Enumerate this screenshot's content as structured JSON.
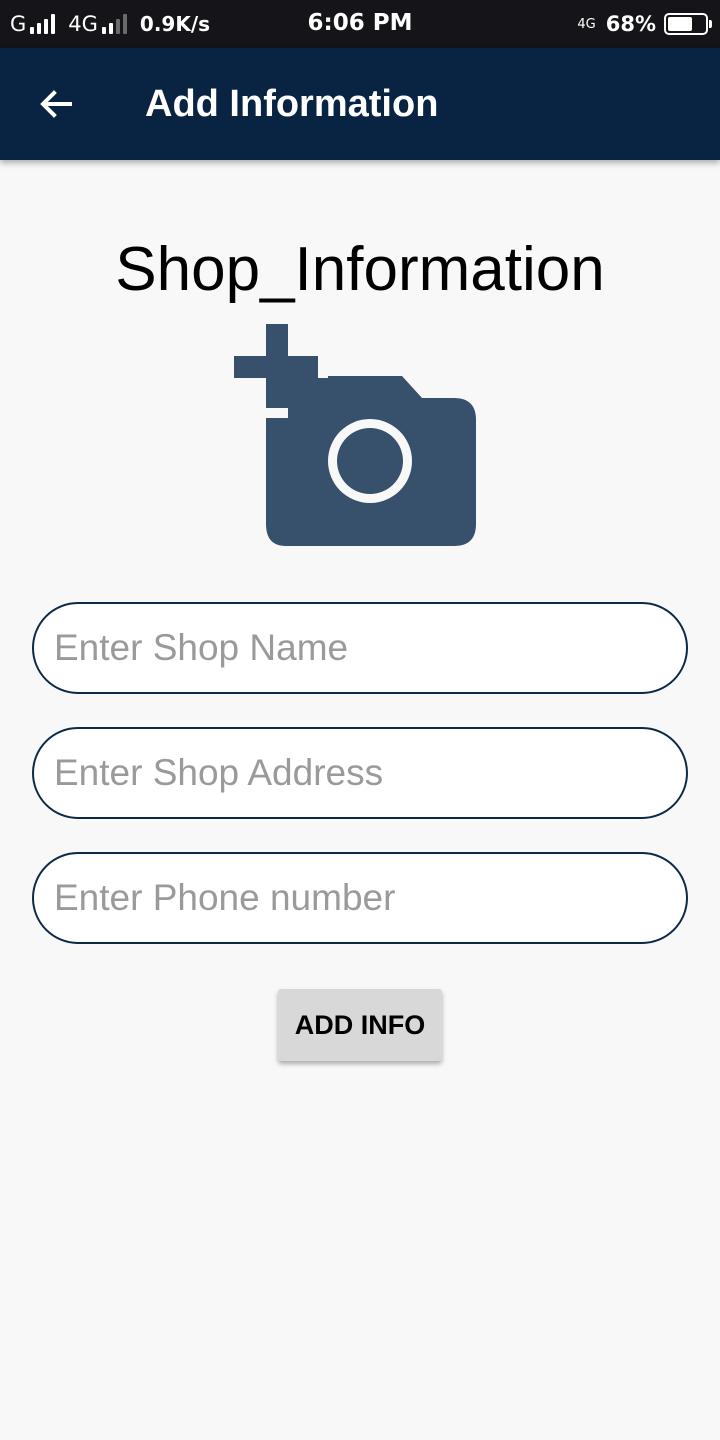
{
  "status_bar": {
    "network1": "G",
    "network2": "4G",
    "speed": "0.9K/s",
    "time": "6:06 PM",
    "lte": "4G",
    "battery": "68%",
    "battery_level": 0.68
  },
  "app_bar": {
    "back_icon": "arrow-left",
    "title": "Add Information"
  },
  "main": {
    "heading": "Shop_Information",
    "camera_icon": "add-a-photo",
    "camera_color": "#37506b",
    "fields": [
      {
        "placeholder": "Enter Shop Name",
        "value": ""
      },
      {
        "placeholder": "Enter Shop Address",
        "value": ""
      },
      {
        "placeholder": "Enter Phone number",
        "value": ""
      }
    ],
    "submit_label": "ADD INFO"
  },
  "colors": {
    "app_bar": "#082442",
    "status_bar": "#151418",
    "background": "#f8f8f8",
    "field_border": "#0b2a47",
    "button_bg": "#d8d8d8"
  }
}
